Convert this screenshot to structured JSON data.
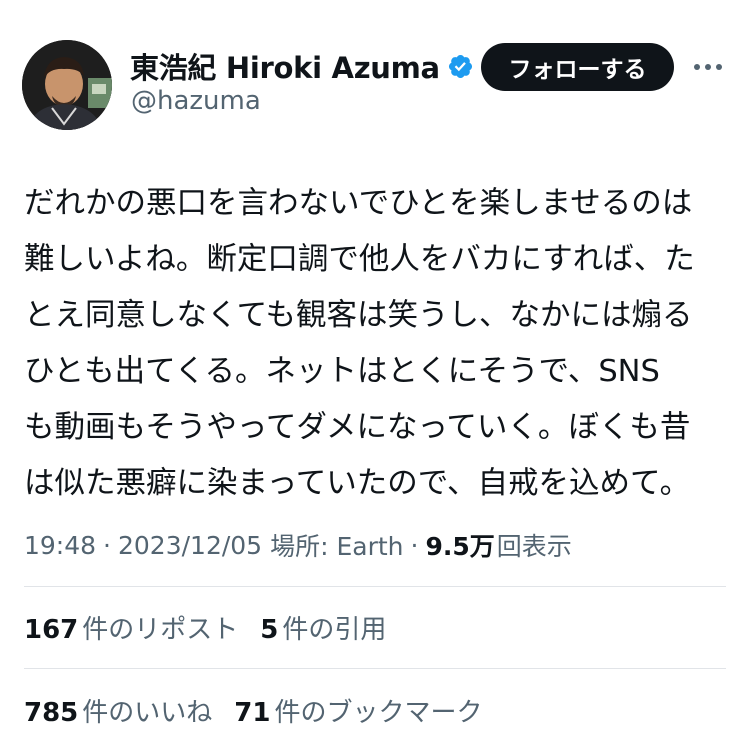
{
  "author": {
    "display_name": "東浩紀 Hiroki Azuma",
    "handle": "@hazuma",
    "verified": true,
    "verified_color": "#1d9bf0"
  },
  "follow_button": {
    "label": "フォローする"
  },
  "more_icon": "more-horizontal-icon",
  "tweet": {
    "lines": [
      "だれかの悪口を言わないでひとを楽しませるのは",
      "難しいよね。断定口調で他人をバカにすれば、た",
      "とえ同意しなくても観客は笑うし、なかには煽る",
      "ひとも出てくる。ネットはとくにそうで、SNS",
      "も動画もそうやってダメになっていく。ぼくも昔",
      "は似た悪癖に染まっていたので、自戒を込めて。"
    ]
  },
  "meta": {
    "time": "19:48",
    "separator": "·",
    "date": "2023/12/05",
    "location": "場所: Earth",
    "views_count": "9.5万",
    "views_label": "回表示"
  },
  "stats": {
    "reposts_count": "167",
    "reposts_label": "件のリポスト",
    "quotes_count": "5",
    "quotes_label": "件の引用",
    "likes_count": "785",
    "likes_label": "件のいいね",
    "bookmarks_count": "71",
    "bookmarks_label": "件のブックマーク"
  },
  "colors": {
    "text_primary": "#0f1419",
    "text_secondary": "#536471",
    "divider": "#e1e4e8",
    "button_bg": "#0f1419"
  }
}
